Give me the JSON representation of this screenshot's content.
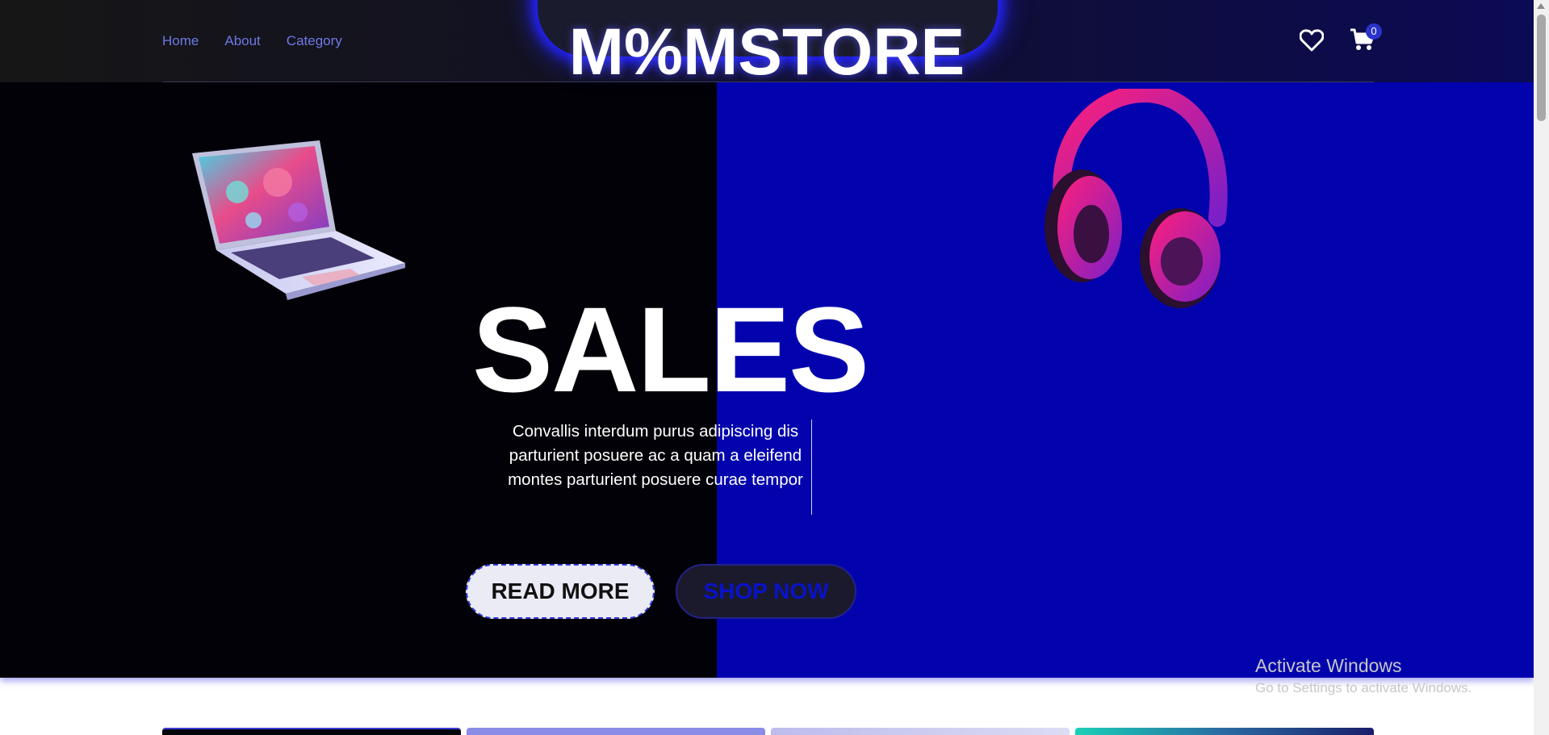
{
  "nav": {
    "links": [
      "Home",
      "About",
      "Category"
    ],
    "logo": "M%MSTORE",
    "cart_count": "0",
    "icons": {
      "wishlist": "heart-icon",
      "cart": "cart-icon"
    }
  },
  "hero": {
    "headline": "SALES",
    "description": "Convallis interdum purus adipiscing dis parturient posuere ac a quam a eleifend montes parturient posuere curae tempor",
    "read_more": "READ MORE",
    "shop_now": "SHOP NOW",
    "colors": {
      "left_bg": "#020107",
      "right_bg": "#0303ae",
      "accent": "#2a34c8"
    }
  },
  "watermark": {
    "title": "Activate Windows",
    "subtitle": "Go to Settings to activate Windows."
  }
}
